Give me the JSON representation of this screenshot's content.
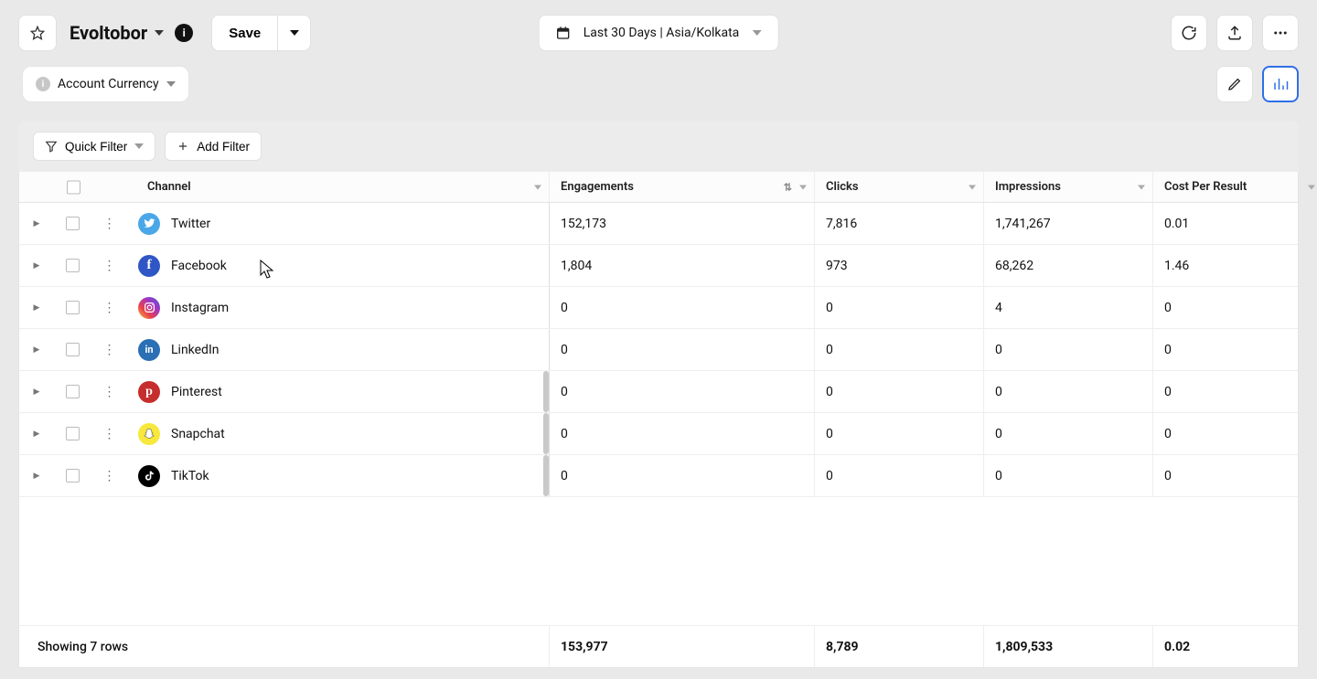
{
  "header": {
    "title": "Evoltobor",
    "save_label": "Save",
    "date_range_label": "Last 30 Days | Asia/Kolkata"
  },
  "secondbar": {
    "currency_label": "Account Currency"
  },
  "filters": {
    "quick_filter_label": "Quick Filter",
    "add_filter_label": "Add Filter"
  },
  "columns": {
    "channel": "Channel",
    "engagements": "Engagements",
    "clicks": "Clicks",
    "impressions": "Impressions",
    "cpr": "Cost Per Result"
  },
  "rows": [
    {
      "channel": "Twitter",
      "icon": "twitter",
      "engagements": "152,173",
      "clicks": "7,816",
      "impressions": "1,741,267",
      "cpr": "0.01"
    },
    {
      "channel": "Facebook",
      "icon": "facebook",
      "engagements": "1,804",
      "clicks": "973",
      "impressions": "68,262",
      "cpr": "1.46"
    },
    {
      "channel": "Instagram",
      "icon": "instagram",
      "engagements": "0",
      "clicks": "0",
      "impressions": "4",
      "cpr": "0"
    },
    {
      "channel": "LinkedIn",
      "icon": "linkedin",
      "engagements": "0",
      "clicks": "0",
      "impressions": "0",
      "cpr": "0"
    },
    {
      "channel": "Pinterest",
      "icon": "pinterest",
      "engagements": "0",
      "clicks": "0",
      "impressions": "0",
      "cpr": "0"
    },
    {
      "channel": "Snapchat",
      "icon": "snapchat",
      "engagements": "0",
      "clicks": "0",
      "impressions": "0",
      "cpr": "0"
    },
    {
      "channel": "TikTok",
      "icon": "tiktok",
      "engagements": "0",
      "clicks": "0",
      "impressions": "0",
      "cpr": "0"
    }
  ],
  "totals": {
    "engagements": "153,977",
    "clicks": "8,789",
    "impressions": "1,809,533",
    "cpr": "0.02"
  },
  "footer": {
    "row_count_text": "Showing 7 rows"
  },
  "icon_colors": {
    "chart_toggle": "#2f6fe8"
  }
}
